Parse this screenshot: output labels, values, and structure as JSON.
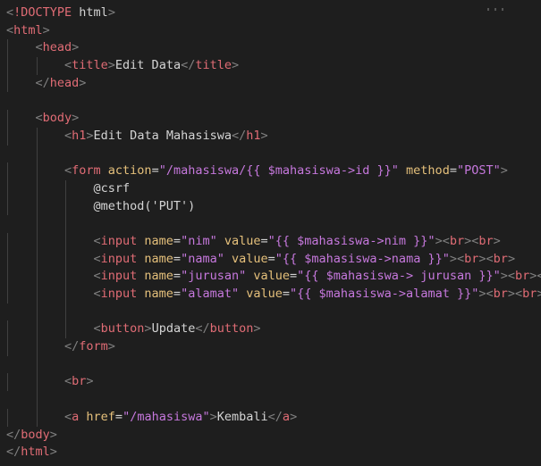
{
  "editor": {
    "lines": [
      {
        "indent": 0,
        "tokens": [
          [
            "<",
            "t-punct"
          ],
          [
            "!DOCTYPE",
            "t-doctype"
          ],
          [
            " html",
            "t-text"
          ],
          [
            ">",
            "t-punct"
          ]
        ]
      },
      {
        "indent": 0,
        "tokens": [
          [
            "<",
            "t-punct"
          ],
          [
            "html",
            "t-tag"
          ],
          [
            ">",
            "t-punct"
          ]
        ]
      },
      {
        "indent": 1,
        "tokens": [
          [
            "<",
            "t-punct"
          ],
          [
            "head",
            "t-tag"
          ],
          [
            ">",
            "t-punct"
          ]
        ]
      },
      {
        "indent": 2,
        "tokens": [
          [
            "<",
            "t-punct"
          ],
          [
            "title",
            "t-tag"
          ],
          [
            ">",
            "t-punct"
          ],
          [
            "Edit Data",
            "t-text"
          ],
          [
            "</",
            "t-punct"
          ],
          [
            "title",
            "t-tag"
          ],
          [
            ">",
            "t-punct"
          ]
        ]
      },
      {
        "indent": 1,
        "tokens": [
          [
            "</",
            "t-punct"
          ],
          [
            "head",
            "t-tag"
          ],
          [
            ">",
            "t-punct"
          ]
        ]
      },
      {
        "indent": 0,
        "tokens": []
      },
      {
        "indent": 1,
        "tokens": [
          [
            "<",
            "t-punct"
          ],
          [
            "body",
            "t-tag"
          ],
          [
            ">",
            "t-punct"
          ]
        ]
      },
      {
        "indent": 2,
        "tokens": [
          [
            "<",
            "t-punct"
          ],
          [
            "h1",
            "t-tag"
          ],
          [
            ">",
            "t-punct"
          ],
          [
            "Edit Data Mahasiswa",
            "t-text"
          ],
          [
            "</",
            "t-punct"
          ],
          [
            "h1",
            "t-tag"
          ],
          [
            ">",
            "t-punct"
          ]
        ]
      },
      {
        "indent": 0,
        "tokens": []
      },
      {
        "indent": 2,
        "tokens": [
          [
            "<",
            "t-punct"
          ],
          [
            "form",
            "t-tag"
          ],
          [
            " action",
            "t-attr"
          ],
          [
            "=",
            "t-text"
          ],
          [
            "\"/mahasiswa/{{ $mahasiswa->id }}\"",
            "t-string"
          ],
          [
            " method",
            "t-attr"
          ],
          [
            "=",
            "t-text"
          ],
          [
            "\"POST\"",
            "t-string"
          ],
          [
            ">",
            "t-punct"
          ]
        ]
      },
      {
        "indent": 3,
        "tokens": [
          [
            "@csrf",
            "t-text"
          ]
        ]
      },
      {
        "indent": 3,
        "tokens": [
          [
            "@method('PUT')",
            "t-text"
          ]
        ]
      },
      {
        "indent": 0,
        "tokens": []
      },
      {
        "indent": 3,
        "tokens": [
          [
            "<",
            "t-punct"
          ],
          [
            "input",
            "t-tag"
          ],
          [
            " name",
            "t-attr"
          ],
          [
            "=",
            "t-text"
          ],
          [
            "\"nim\"",
            "t-string"
          ],
          [
            " value",
            "t-attr"
          ],
          [
            "=",
            "t-text"
          ],
          [
            "\"{{ $mahasiswa->nim }}\"",
            "t-string"
          ],
          [
            ">",
            "t-punct"
          ],
          [
            "<",
            "t-punct"
          ],
          [
            "br",
            "t-tag"
          ],
          [
            ">",
            "t-punct"
          ],
          [
            "<",
            "t-punct"
          ],
          [
            "br",
            "t-tag"
          ],
          [
            ">",
            "t-punct"
          ]
        ]
      },
      {
        "indent": 3,
        "tokens": [
          [
            "<",
            "t-punct"
          ],
          [
            "input",
            "t-tag"
          ],
          [
            " name",
            "t-attr"
          ],
          [
            "=",
            "t-text"
          ],
          [
            "\"nama\"",
            "t-string"
          ],
          [
            " value",
            "t-attr"
          ],
          [
            "=",
            "t-text"
          ],
          [
            "\"{{ $mahasiswa->nama }}\"",
            "t-string"
          ],
          [
            ">",
            "t-punct"
          ],
          [
            "<",
            "t-punct"
          ],
          [
            "br",
            "t-tag"
          ],
          [
            ">",
            "t-punct"
          ],
          [
            "<",
            "t-punct"
          ],
          [
            "br",
            "t-tag"
          ],
          [
            ">",
            "t-punct"
          ]
        ]
      },
      {
        "indent": 3,
        "tokens": [
          [
            "<",
            "t-punct"
          ],
          [
            "input",
            "t-tag"
          ],
          [
            " name",
            "t-attr"
          ],
          [
            "=",
            "t-text"
          ],
          [
            "\"jurusan\"",
            "t-string"
          ],
          [
            " value",
            "t-attr"
          ],
          [
            "=",
            "t-text"
          ],
          [
            "\"{{ $mahasiswa-> jurusan }}\"",
            "t-string"
          ],
          [
            ">",
            "t-punct"
          ],
          [
            "<",
            "t-punct"
          ],
          [
            "br",
            "t-tag"
          ],
          [
            ">",
            "t-punct"
          ],
          [
            "<",
            "t-punct"
          ],
          [
            "br",
            "t-tag"
          ],
          [
            ">",
            "t-punct"
          ]
        ]
      },
      {
        "indent": 3,
        "tokens": [
          [
            "<",
            "t-punct"
          ],
          [
            "input",
            "t-tag"
          ],
          [
            " name",
            "t-attr"
          ],
          [
            "=",
            "t-text"
          ],
          [
            "\"alamat\"",
            "t-string"
          ],
          [
            " value",
            "t-attr"
          ],
          [
            "=",
            "t-text"
          ],
          [
            "\"{{ $mahasiswa->alamat }}\"",
            "t-string"
          ],
          [
            ">",
            "t-punct"
          ],
          [
            "<",
            "t-punct"
          ],
          [
            "br",
            "t-tag"
          ],
          [
            ">",
            "t-punct"
          ],
          [
            "<",
            "t-punct"
          ],
          [
            "br",
            "t-tag"
          ],
          [
            ">",
            "t-punct"
          ]
        ]
      },
      {
        "indent": 0,
        "tokens": []
      },
      {
        "indent": 3,
        "tokens": [
          [
            "<",
            "t-punct"
          ],
          [
            "button",
            "t-tag"
          ],
          [
            ">",
            "t-punct"
          ],
          [
            "Update",
            "t-text"
          ],
          [
            "</",
            "t-punct"
          ],
          [
            "button",
            "t-tag"
          ],
          [
            ">",
            "t-punct"
          ]
        ]
      },
      {
        "indent": 2,
        "tokens": [
          [
            "</",
            "t-punct"
          ],
          [
            "form",
            "t-tag"
          ],
          [
            ">",
            "t-punct"
          ]
        ]
      },
      {
        "indent": 0,
        "tokens": []
      },
      {
        "indent": 2,
        "tokens": [
          [
            "<",
            "t-punct"
          ],
          [
            "br",
            "t-tag"
          ],
          [
            ">",
            "t-punct"
          ]
        ]
      },
      {
        "indent": 0,
        "tokens": []
      },
      {
        "indent": 2,
        "tokens": [
          [
            "<",
            "t-punct"
          ],
          [
            "a",
            "t-tag"
          ],
          [
            " href",
            "t-attr"
          ],
          [
            "=",
            "t-text"
          ],
          [
            "\"/mahasiswa\"",
            "t-string"
          ],
          [
            ">",
            "t-punct"
          ],
          [
            "Kembali",
            "t-text"
          ],
          [
            "</",
            "t-punct"
          ],
          [
            "a",
            "t-tag"
          ],
          [
            ">",
            "t-punct"
          ]
        ]
      },
      {
        "indent": 0,
        "tokens": [
          [
            "</",
            "t-punct"
          ],
          [
            "body",
            "t-tag"
          ],
          [
            ">",
            "t-punct"
          ]
        ]
      },
      {
        "indent": 0,
        "tokens": [
          [
            "</",
            "t-punct"
          ],
          [
            "html",
            "t-tag"
          ],
          [
            ">",
            "t-punct"
          ]
        ]
      }
    ]
  }
}
